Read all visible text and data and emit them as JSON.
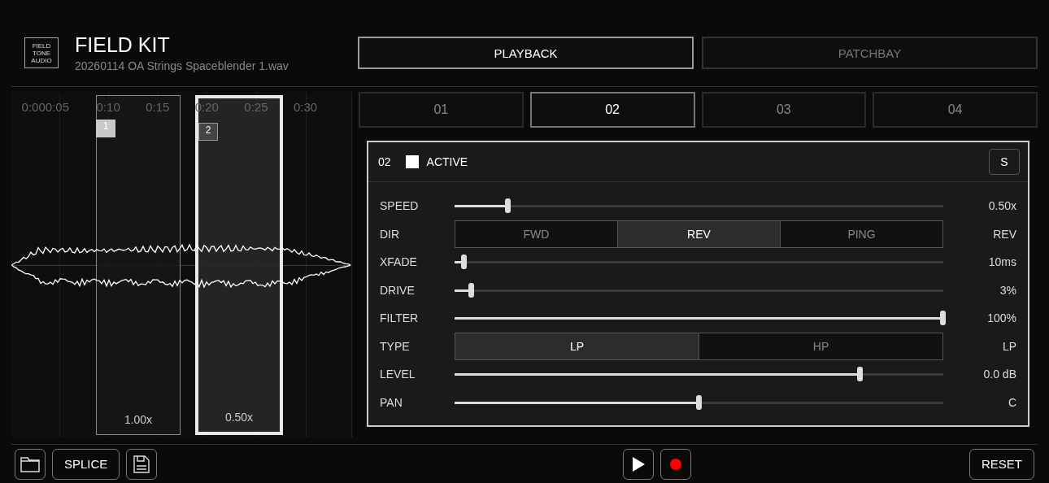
{
  "app": {
    "title": "FIELD KIT",
    "file": "20260114 OA Strings Spaceblender 1.wav",
    "logo": [
      "FIELD",
      "TONE",
      "AUDIO"
    ]
  },
  "mode_tabs": [
    {
      "label": "PLAYBACK",
      "selected": true
    },
    {
      "label": "PATCHBAY",
      "selected": false
    }
  ],
  "timeline": {
    "ticks": [
      {
        "label": "0:000:05"
      },
      {
        "label": "0:10"
      },
      {
        "label": "0:15"
      },
      {
        "label": "0:20"
      },
      {
        "label": "0:25"
      },
      {
        "label": "0:30"
      }
    ],
    "slices": [
      {
        "number": "1",
        "speed": "1.00x",
        "selected": false
      },
      {
        "number": "2",
        "speed": "0.50x",
        "selected": true
      }
    ]
  },
  "slot_tabs": [
    {
      "label": "01",
      "selected": false
    },
    {
      "label": "02",
      "selected": true
    },
    {
      "label": "03",
      "selected": false
    },
    {
      "label": "04",
      "selected": false
    }
  ],
  "slot": {
    "number": "02",
    "active": true,
    "active_label": "ACTIVE",
    "solo_label": "S"
  },
  "params": [
    {
      "kind": "slider",
      "label": "SPEED",
      "level": 0.11,
      "reading": "0.50x"
    },
    {
      "kind": "segmented",
      "label": "DIR",
      "options": [
        {
          "label": "FWD",
          "selected": false
        },
        {
          "label": "REV",
          "selected": true
        },
        {
          "label": "PING",
          "selected": false
        }
      ],
      "reading": "REV"
    },
    {
      "kind": "slider",
      "label": "XFADE",
      "level": 0.02,
      "reading": "10ms"
    },
    {
      "kind": "slider",
      "label": "DRIVE",
      "level": 0.035,
      "reading": "3%"
    },
    {
      "kind": "slider",
      "label": "FILTER",
      "level": 1.0,
      "reading": "100%"
    },
    {
      "kind": "segmented",
      "label": "TYPE",
      "options": [
        {
          "label": "LP",
          "selected": true
        },
        {
          "label": "HP",
          "selected": false
        }
      ],
      "reading": "LP"
    },
    {
      "kind": "slider",
      "label": "LEVEL",
      "level": 0.83,
      "reading": "0.0 dB"
    },
    {
      "kind": "slider",
      "label": "PAN",
      "level": 0.5,
      "reading": "C"
    }
  ],
  "footer": {
    "splice_label": "SPLICE",
    "reset_label": "RESET"
  }
}
